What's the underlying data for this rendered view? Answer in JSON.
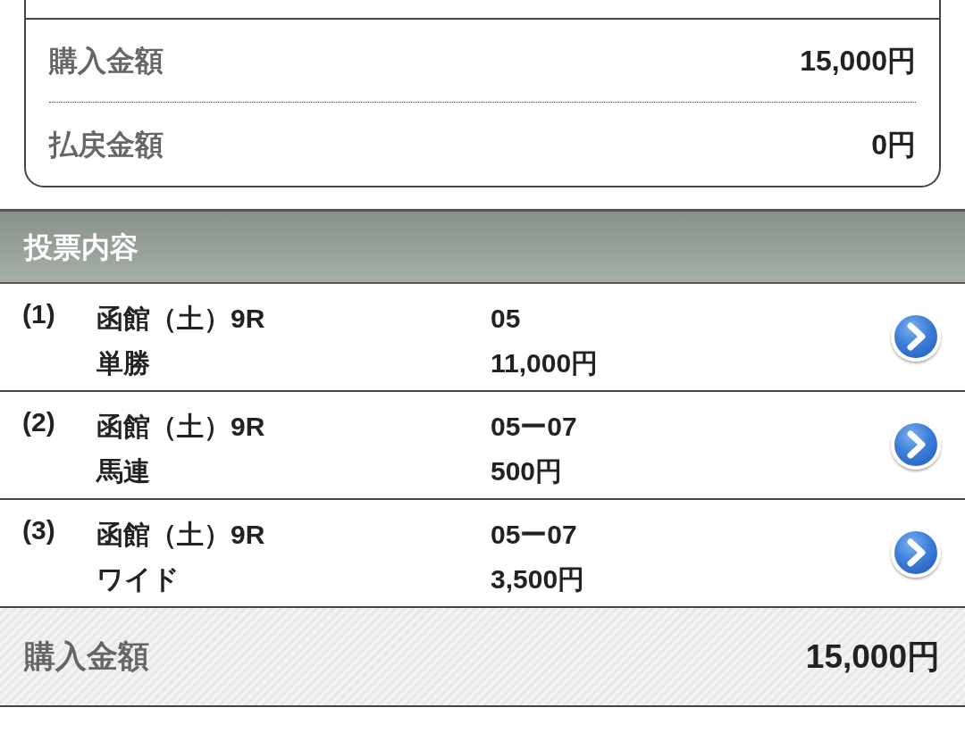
{
  "summary": {
    "rows": [
      {
        "label": "購入金額",
        "value": "15,000円"
      },
      {
        "label": "払戻金額",
        "value": "0円"
      }
    ]
  },
  "section": {
    "title": "投票内容"
  },
  "bets": [
    {
      "number": "(1)",
      "venue": "函館（土）9R",
      "type": "単勝",
      "selection": "05",
      "amount": "11,000円"
    },
    {
      "number": "(2)",
      "venue": "函館（土）9R",
      "type": "馬連",
      "selection": "05ー07",
      "amount": "500円"
    },
    {
      "number": "(3)",
      "venue": "函館（土）9R",
      "type": "ワイド",
      "selection": "05ー07",
      "amount": "3,500円"
    }
  ],
  "total": {
    "label": "購入金額",
    "value": "15,000円"
  }
}
